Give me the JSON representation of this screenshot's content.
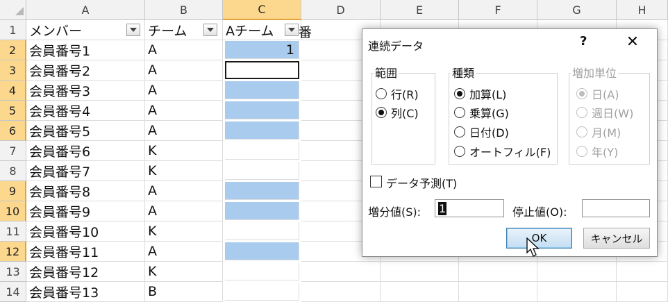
{
  "sheet": {
    "columns": [
      "A",
      "B",
      "C",
      "D",
      "E",
      "F",
      "G",
      "H"
    ],
    "rows": [
      "1",
      "2",
      "3",
      "4",
      "5",
      "6",
      "7",
      "8",
      "9",
      "10",
      "11",
      "12",
      "13",
      "14"
    ],
    "header_row": {
      "a": "メンバー",
      "b": "チーム",
      "c": "Aチーム",
      "c_overflow": "番"
    },
    "data": [
      {
        "a": "会員番号1",
        "b": "A",
        "c": "1"
      },
      {
        "a": "会員番号2",
        "b": "A",
        "c": ""
      },
      {
        "a": "会員番号3",
        "b": "A",
        "c": ""
      },
      {
        "a": "会員番号4",
        "b": "A",
        "c": ""
      },
      {
        "a": "会員番号5",
        "b": "A",
        "c": ""
      },
      {
        "a": "会員番号6",
        "b": "K",
        "c": ""
      },
      {
        "a": "会員番号7",
        "b": "K",
        "c": ""
      },
      {
        "a": "会員番号8",
        "b": "A",
        "c": ""
      },
      {
        "a": "会員番号9",
        "b": "A",
        "c": ""
      },
      {
        "a": "会員番号10",
        "b": "K",
        "c": ""
      },
      {
        "a": "会員番号11",
        "b": "A",
        "c": ""
      },
      {
        "a": "会員番号12",
        "b": "K",
        "c": ""
      },
      {
        "a": "会員番号13",
        "b": "B",
        "c": ""
      }
    ],
    "highlight_color": "#a8cbee",
    "selected_header_color": "#fbd88e"
  },
  "dialog": {
    "title": "連続データ",
    "help": "?",
    "close": "✕",
    "range_group": {
      "label": "範囲",
      "options": [
        {
          "label": "行(R)",
          "selected": false
        },
        {
          "label": "列(C)",
          "selected": true
        }
      ]
    },
    "type_group": {
      "label": "種類",
      "options": [
        {
          "label": "加算(L)",
          "selected": true
        },
        {
          "label": "乗算(G)",
          "selected": false
        },
        {
          "label": "日付(D)",
          "selected": false
        },
        {
          "label": "オートフィル(F)",
          "selected": false
        }
      ]
    },
    "unit_group": {
      "label": "増加単位",
      "options": [
        {
          "label": "日(A)",
          "selected": true
        },
        {
          "label": "週日(W)",
          "selected": false
        },
        {
          "label": "月(M)",
          "selected": false
        },
        {
          "label": "年(Y)",
          "selected": false
        }
      ]
    },
    "trend_checkbox": {
      "label": "データ予測(T)",
      "checked": false
    },
    "step_label": "増分値(S):",
    "step_value": "1",
    "stop_label": "停止値(O):",
    "stop_value": "",
    "ok_label": "OK",
    "cancel_label": "キャンセル"
  }
}
